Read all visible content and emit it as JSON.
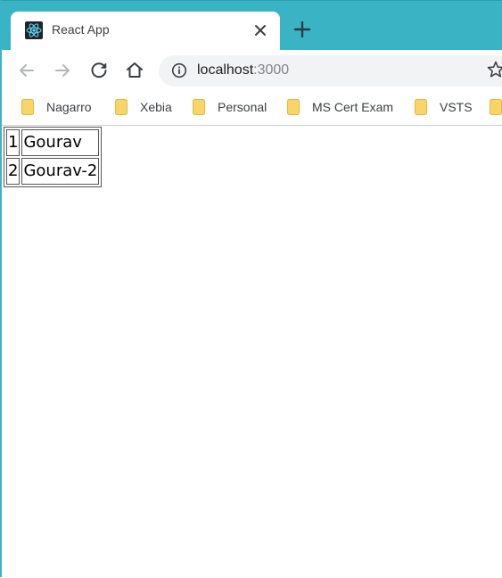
{
  "browser": {
    "tab": {
      "title": "React App",
      "favicon": "react-logo-icon"
    },
    "new_tab_icon": "plus-icon",
    "address_bar": {
      "host": "localhost",
      "port": ":3000",
      "info_icon": "info-icon"
    },
    "bookmarks": [
      {
        "label": "Nagarro"
      },
      {
        "label": "Xebia"
      },
      {
        "label": "Personal"
      },
      {
        "label": "MS Cert Exam"
      },
      {
        "label": "VSTS"
      }
    ],
    "colors": {
      "tabstrip": "#3ab4c5",
      "folder": "#f9d469"
    }
  },
  "page": {
    "rows": [
      {
        "id": "1",
        "name": "Gourav"
      },
      {
        "id": "2",
        "name": "Gourav-2"
      }
    ]
  }
}
